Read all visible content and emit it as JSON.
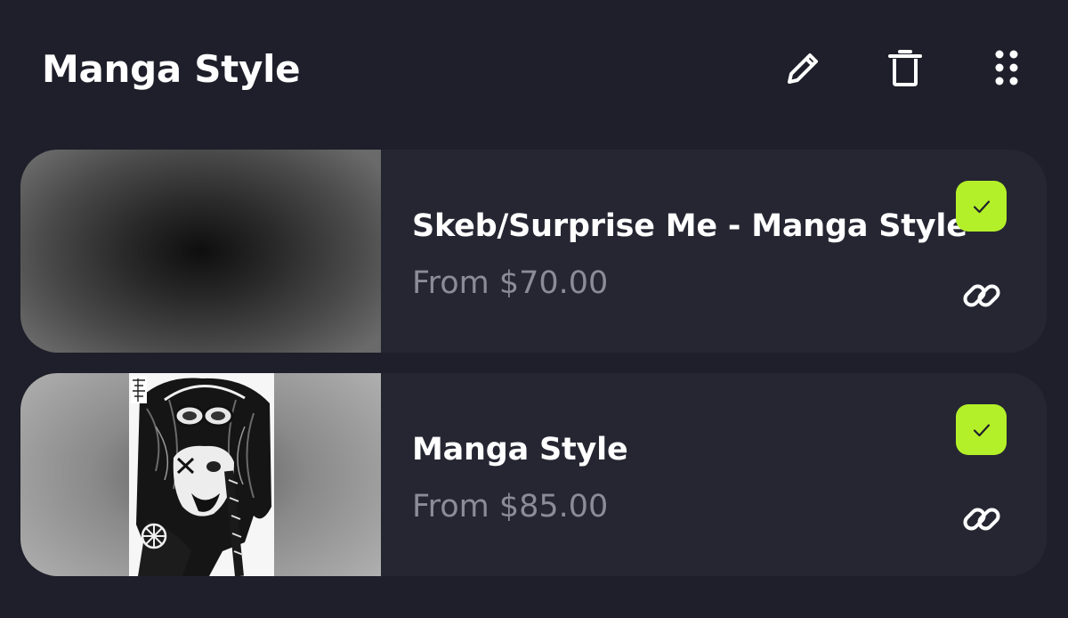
{
  "header": {
    "title": "Manga Style"
  },
  "icons": {
    "edit": "pencil-icon",
    "delete": "trash-icon",
    "more": "grid-dots-icon",
    "check": "check-icon",
    "link": "link-icon"
  },
  "colors": {
    "background": "#1f1f2b",
    "card": "#262633",
    "accent": "#b4f029",
    "price": "#8c8c98"
  },
  "items": [
    {
      "title": "Skeb/Surprise Me - Manga Style",
      "price": "From $70.00",
      "selected": true
    },
    {
      "title": "Manga Style",
      "price": "From $85.00",
      "selected": true
    }
  ]
}
